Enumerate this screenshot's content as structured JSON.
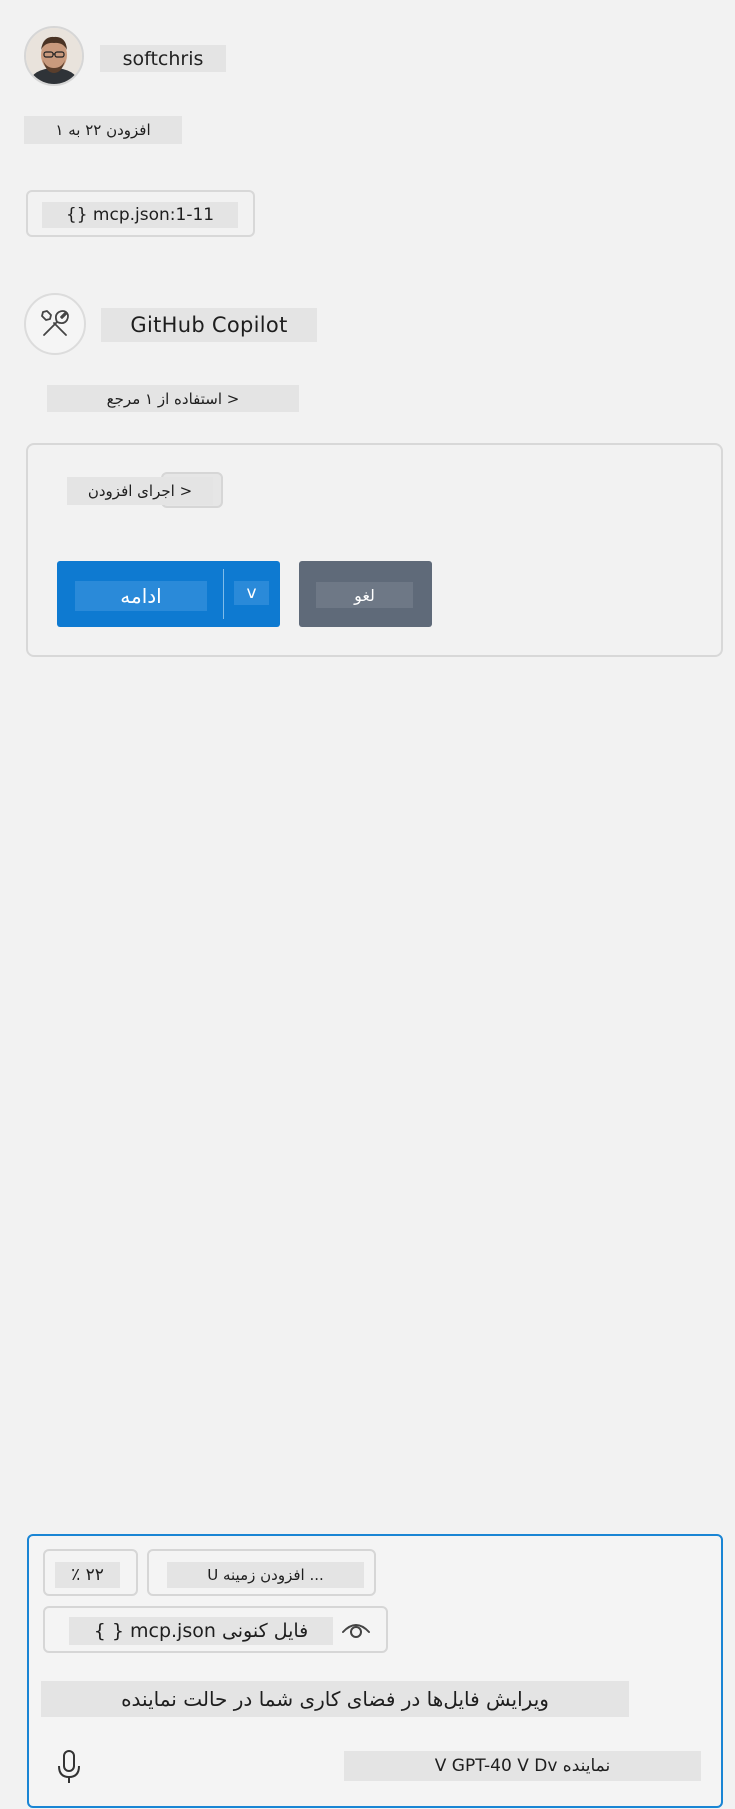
{
  "user": {
    "name": "softchris",
    "added_files": "افزودن ۲۲ به ۱"
  },
  "file_reference": "{} mcp.json:1-11",
  "assistant": {
    "name": "GitHub Copilot",
    "references": "< استفاده از ۱ مرجع",
    "run_label": "< اجرای افزودن",
    "continue_label": "ادامه",
    "continue_dropdown": "v",
    "cancel_label": "لغو"
  },
  "composer": {
    "percent": "٪ ۲۲",
    "add_context": "... افزودن زمینه U",
    "current_file": "{ } mcp.json فایل کنونی",
    "placeholder": "ویرایش فایل‌ها در فضای کاری شما در حالت نماینده",
    "mode": "V GPT-40 V Dv نماینده"
  },
  "icons": {
    "avatar": "user-avatar-photo",
    "tools": "tools-icon",
    "eye": "eye-icon",
    "mic": "microphone-icon"
  },
  "colors": {
    "primary_button": "#0e7ad1",
    "secondary_button": "#5f6a79",
    "focus_border": "#1a85d4"
  }
}
